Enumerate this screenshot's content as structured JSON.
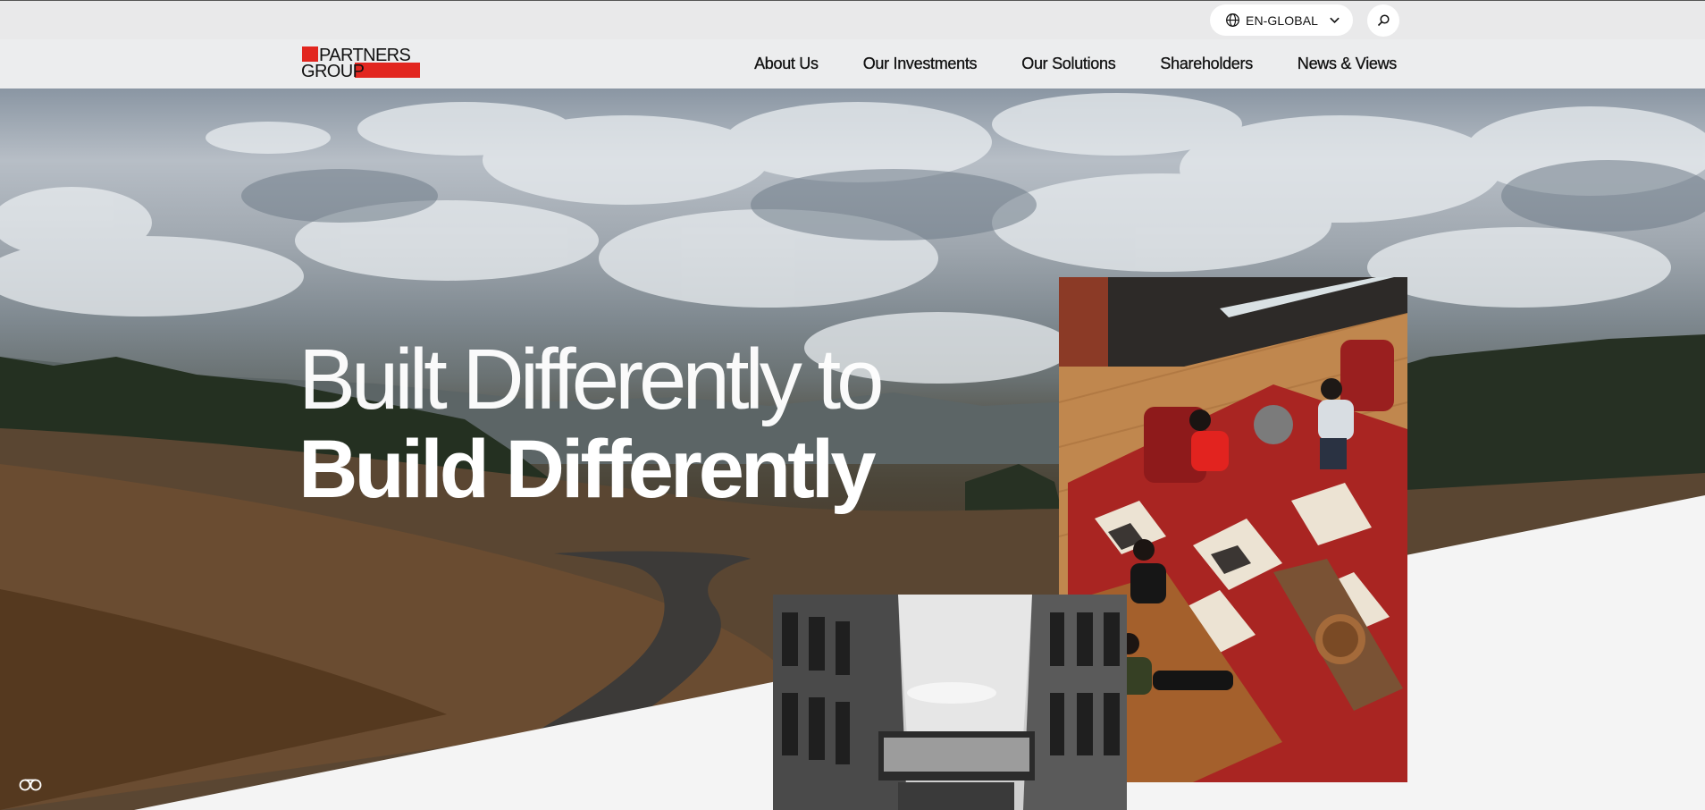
{
  "topbar": {
    "language_label": "EN-GLOBAL",
    "language_icon": "globe-icon",
    "search_icon": "search-icon"
  },
  "brand": {
    "name_line1": "PARTNERS",
    "name_line2": "GROUP",
    "accent_color": "#e2261f"
  },
  "nav": {
    "items": [
      {
        "label": "About Us"
      },
      {
        "label": "Our Investments"
      },
      {
        "label": "Our Solutions"
      },
      {
        "label": "Shareholders"
      },
      {
        "label": "News & Views"
      }
    ]
  },
  "hero": {
    "title_line1": "Built Differently to",
    "title_line2": "Build Differently"
  },
  "cookie": {
    "icon": "cookie-settings-icon"
  }
}
